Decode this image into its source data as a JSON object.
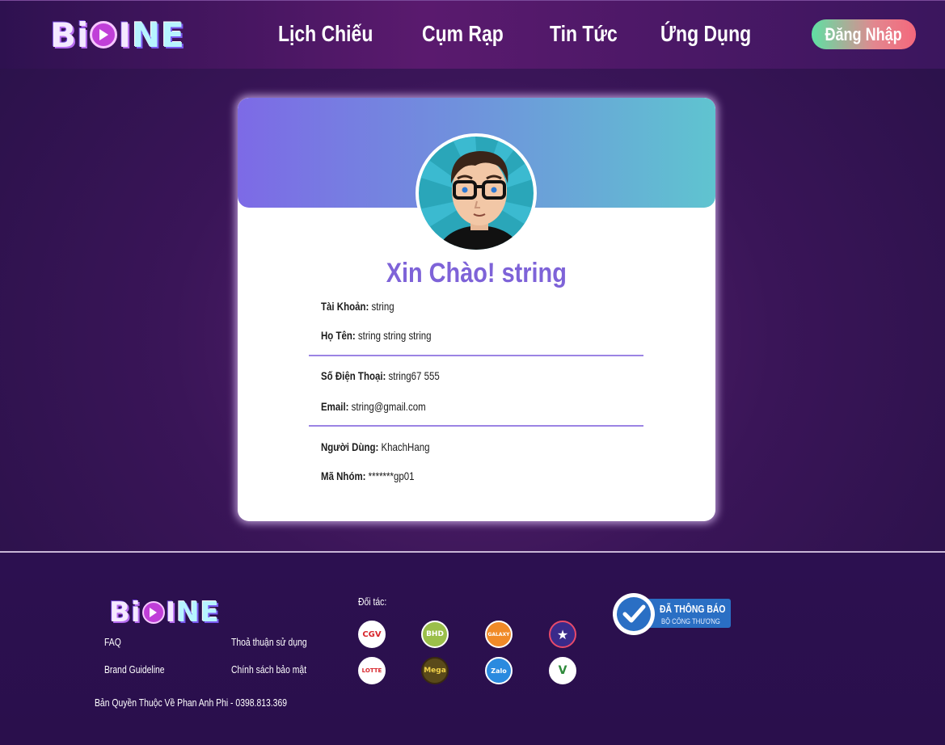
{
  "header": {
    "logo_left": "Bi",
    "logo_right": "NE",
    "nav": [
      "Lịch Chiếu",
      "Cụm Rạp",
      "Tin Tức",
      "Ứng Dụng"
    ],
    "login_label": "Đăng Nhập"
  },
  "profile": {
    "greeting": "Xin Chào! string",
    "fields": [
      {
        "label": "Tài Khoản:",
        "value": "string"
      },
      {
        "label": "Họ Tên:",
        "value": "string string string"
      },
      {
        "label": "Số Điện Thoại:",
        "value": "string67 555"
      },
      {
        "label": "Email:",
        "value": "string@gmail.com"
      },
      {
        "label": "Người Dùng:",
        "value": "KhachHang"
      },
      {
        "label": "Mã Nhóm:",
        "value": "*******gp01"
      }
    ]
  },
  "footer": {
    "logo_left": "Bi",
    "logo_right": "NE",
    "links": {
      "faq": "FAQ",
      "terms": "Thoả thuận sử dụng",
      "brand": "Brand Guideline",
      "privacy": "Chính sách bảo mật"
    },
    "partners_title": "Đối tác:",
    "partners": [
      {
        "name": "CGV",
        "icon": "cgv-logo",
        "color": "#ffffff",
        "text_color": "#d8262c"
      },
      {
        "name": "BHD",
        "icon": "bhd-logo",
        "color": "#9bbf4a",
        "text_color": "#ffffff"
      },
      {
        "name": "GALAXY",
        "icon": "galaxy-logo",
        "color": "#f08a28",
        "text_color": "#ffffff"
      },
      {
        "name": "★",
        "icon": "cinestar-logo",
        "color": "#3a2a8a",
        "text_color": "#ffffff"
      },
      {
        "name": "LOTTE",
        "icon": "lotte-logo",
        "color": "#ffffff",
        "text_color": "#d8262c"
      },
      {
        "name": "Mega",
        "icon": "megags-logo",
        "color": "#5a4a1a",
        "text_color": "#f2d24a"
      },
      {
        "name": "Zalo",
        "icon": "zalopay-logo",
        "color": "#2a8adf",
        "text_color": "#ffffff"
      },
      {
        "name": "V",
        "icon": "vietcombank-logo",
        "color": "#ffffff",
        "text_color": "#2e8a3a"
      }
    ],
    "notice_line1": "ĐÃ THÔNG BÁO",
    "notice_line2": "BỘ CÔNG THƯƠNG",
    "copyright": "Bản Quyền Thuộc Về Phan Anh Phi - 0398.813.369"
  }
}
